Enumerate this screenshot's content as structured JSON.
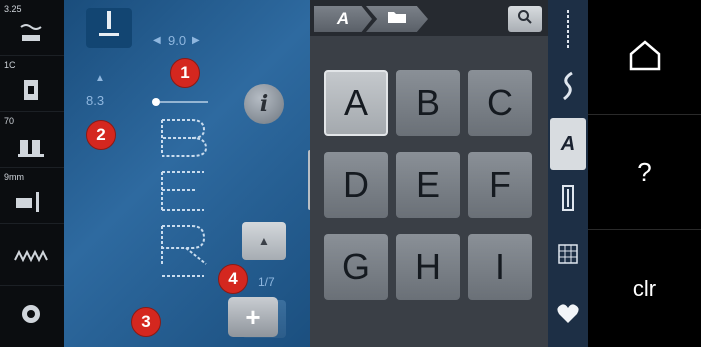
{
  "left_status": {
    "items": [
      {
        "label": "3.25",
        "icon": "presser-foot-icon"
      },
      {
        "label": "1C",
        "icon": "sewing-foot-icon"
      },
      {
        "label": "70",
        "icon": "needle-icon"
      },
      {
        "label": "9mm",
        "icon": "stitch-plate-icon"
      },
      {
        "label": "",
        "icon": "feed-dog-icon"
      },
      {
        "label": "",
        "icon": "tension-icon"
      }
    ]
  },
  "edit": {
    "stitch_width": "9.0",
    "stitch_length": "8.3",
    "page_counter": "1/7",
    "info_label": "i",
    "plus_label": "+"
  },
  "callouts": [
    "1",
    "2",
    "3",
    "4"
  ],
  "alphabet": {
    "keys": [
      "A",
      "B",
      "C",
      "D",
      "E",
      "F",
      "G",
      "H",
      "I"
    ],
    "selected": "A",
    "crumb_font": "A"
  },
  "categories": [
    "utility-stitches-icon",
    "decorative-stitches-icon",
    "alphabets-icon",
    "buttonholes-icon",
    "quilt-stitches-icon",
    "personal-program-icon"
  ],
  "nav": {
    "home_label": "",
    "help_label": "?",
    "clear_label": "clr"
  },
  "colors": {
    "badge": "#d4271f",
    "edit_bg": "#2e6aa0",
    "key": "#7a8087"
  }
}
